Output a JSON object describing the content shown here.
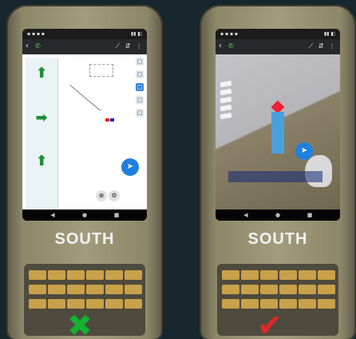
{
  "devices": {
    "left": {
      "brand": "SOUTH",
      "mark": "✖",
      "mark_color": "#12b033",
      "mark_icon": "cross-icon"
    },
    "right": {
      "brand": "SOUTH",
      "mark": "✔",
      "mark_color": "#e02828",
      "mark_icon": "check-icon"
    }
  },
  "colors": {
    "background": "#16262c",
    "map_background": "#ffffff",
    "arrow_green": "#1f8f3a",
    "location_blue": "#1f7fe0"
  },
  "icons": [
    "phone-icon",
    "back-icon",
    "arrow-up-icon",
    "arrow-right-icon",
    "location-icon",
    "home-icon",
    "recent-apps-icon"
  ]
}
